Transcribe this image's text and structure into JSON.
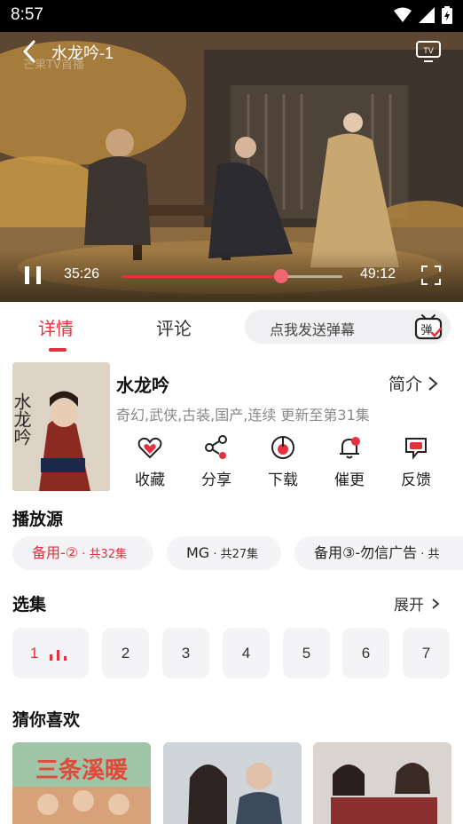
{
  "status_bar": {
    "time": "8:57"
  },
  "player": {
    "title": "水龙吟-1",
    "watermark": "芒果TV首播",
    "current_time": "35:26",
    "total_time": "49:12",
    "progress": 0.72
  },
  "tabs": {
    "detail": "详情",
    "comment": "评论"
  },
  "danmu": {
    "placeholder": "点我发送弹幕",
    "icon_label": "弹"
  },
  "show": {
    "title": "水龙吟",
    "intro_label": "简介",
    "meta": "奇幻,武侠,古装,国产,连续 更新至第31集",
    "poster_text": "水龙吟"
  },
  "actions": [
    {
      "label": "收藏",
      "icon": "heart-icon"
    },
    {
      "label": "分享",
      "icon": "share-icon"
    },
    {
      "label": "下载",
      "icon": "download-icon"
    },
    {
      "label": "催更",
      "icon": "bell-icon"
    },
    {
      "label": "反馈",
      "icon": "feedback-icon"
    }
  ],
  "sources": {
    "title": "播放源",
    "items": [
      {
        "name": "备用-②",
        "count": " · 共32集",
        "active": true
      },
      {
        "name": "MG",
        "count": " · 共27集",
        "active": false
      },
      {
        "name": "备用③-勿信广告",
        "count": " · 共",
        "active": false
      }
    ]
  },
  "episodes": {
    "title": "选集",
    "expand_label": "展开",
    "items": [
      "1",
      "2",
      "3",
      "4",
      "5",
      "6",
      "7"
    ]
  },
  "recommend": {
    "title": "猜你喜欢",
    "items": [
      {
        "poster_text": "三条溪暖"
      },
      {
        "poster_text": ""
      },
      {
        "poster_text": ""
      }
    ]
  },
  "colors": {
    "accent": "#e5303d",
    "chip_bg": "#f4f4f6"
  }
}
